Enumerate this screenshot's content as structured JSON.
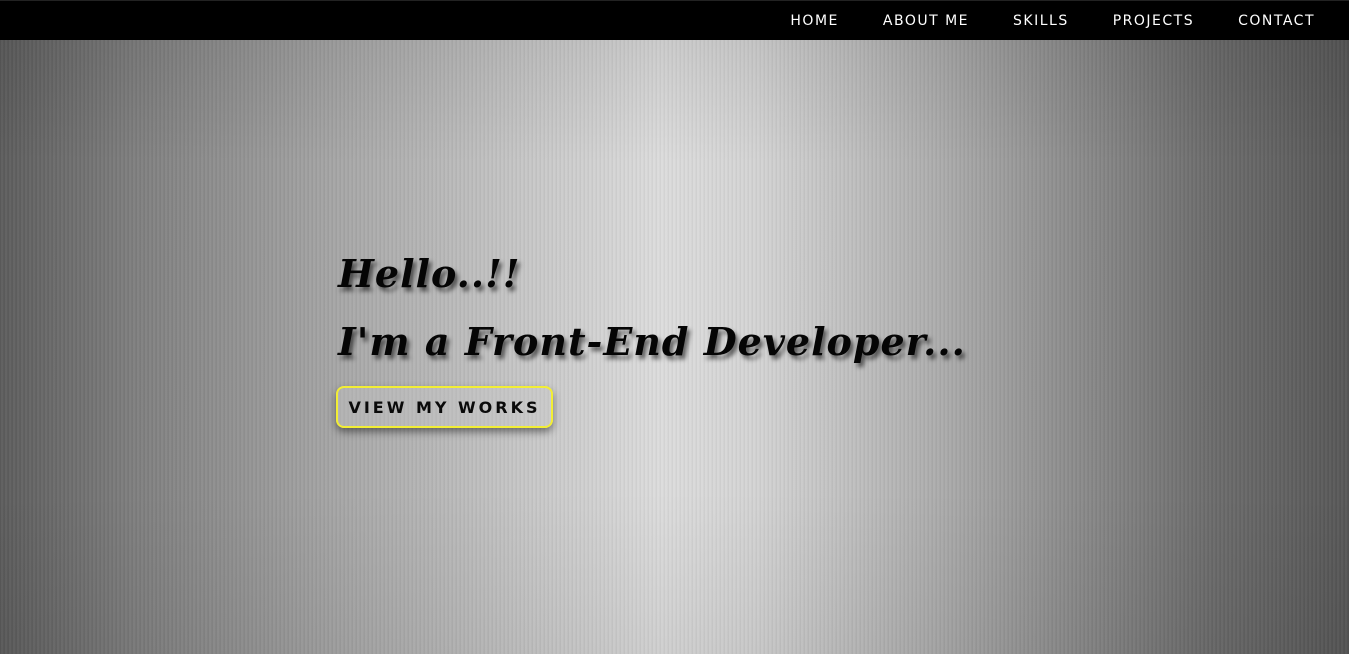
{
  "nav": {
    "items": [
      {
        "label": "HOME"
      },
      {
        "label": "ABOUT ME"
      },
      {
        "label": "SKILLS"
      },
      {
        "label": "PROJECTS"
      },
      {
        "label": "CONTACT"
      }
    ]
  },
  "hero": {
    "greeting_line1": "Hello..!!",
    "greeting_line2": "I'm a Front-End Developer...",
    "cta_label": "VIEW MY WORKS"
  },
  "colors": {
    "navbar_bg": "#000000",
    "nav_text": "#ffffff",
    "cta_border": "#f2ee34",
    "headline_text": "#050505"
  }
}
